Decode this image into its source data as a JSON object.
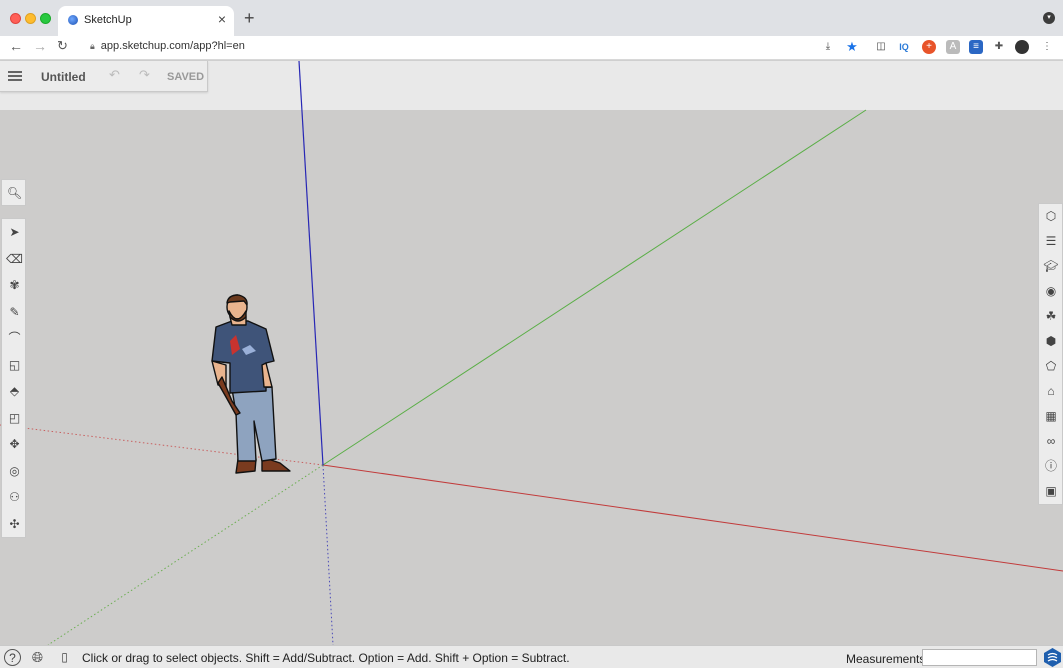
{
  "browser": {
    "tab_title": "SketchUp",
    "tab_close": "×",
    "new_tab": "+",
    "url": "app.sketchup.com/app?hl=en",
    "ext_iq": "IQ"
  },
  "app": {
    "document_title": "Untitled",
    "save_status": "SAVED"
  },
  "left_tools": [
    "search-icon",
    "select-icon",
    "eraser-icon",
    "paint-bucket-icon",
    "pencil-icon",
    "arc-icon",
    "rectangle-icon",
    "push-pull-icon",
    "offset-icon",
    "move-icon",
    "tape-measure-icon",
    "walk-icon",
    "orbit-icon"
  ],
  "right_panels": [
    "entity-info-icon",
    "outliner-icon",
    "instructor-icon",
    "styles-icon",
    "materials-icon",
    "components-icon",
    "solid-tools-icon",
    "tags-icon",
    "scenes-icon",
    "display-icon",
    "info-icon",
    "model-info-icon"
  ],
  "status": {
    "hint": "Click or drag to select objects. Shift = Add/Subtract. Option = Add. Shift + Option = Subtract.",
    "measurements_label": "Measurements",
    "measurements_value": ""
  },
  "colors": {
    "axis_red": "#c83a3a",
    "axis_green": "#5fb34a",
    "axis_blue": "#2a2ab8",
    "viewport_bg": "#cdcccb"
  }
}
